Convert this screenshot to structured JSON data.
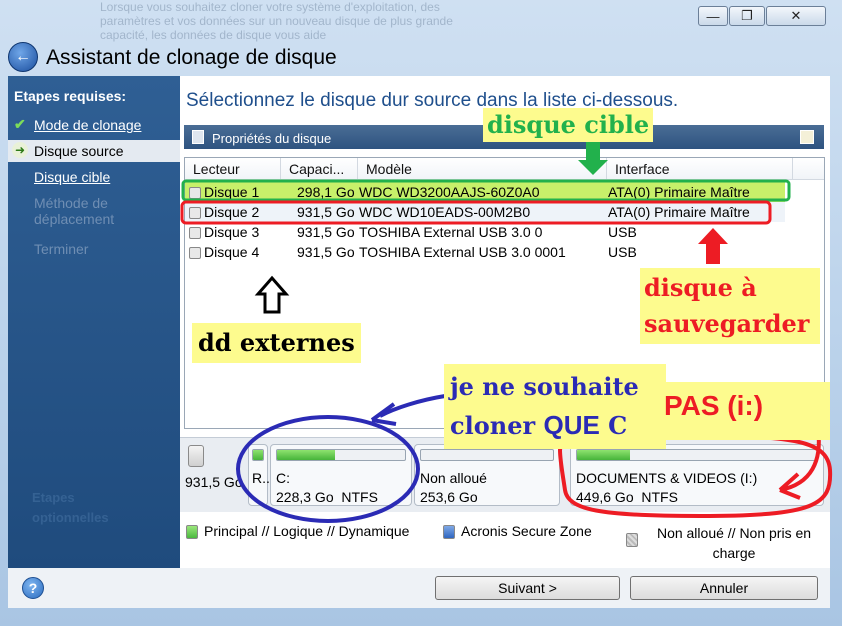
{
  "window": {
    "title": "Assistant de clonage de disque",
    "min_glyph": "—",
    "max_glyph": "❐",
    "close_glyph": "✕",
    "background_text": "Lorsque vous souhaitez cloner votre système d'exploitation, des paramètres et vos données sur un nouveau disque de plus grande capacité, les données de disque vous aide"
  },
  "sidebar": {
    "heading": "Etapes requises:",
    "items": [
      {
        "label": "Mode de clonage",
        "state": "done"
      },
      {
        "label": "Disque source",
        "state": "current"
      },
      {
        "label": "Disque cible",
        "state": "link"
      },
      {
        "label": "Méthode de déplacement",
        "state": "disabled"
      },
      {
        "label": "Terminer",
        "state": "disabled"
      }
    ],
    "optional_heading": "Etapes optionnelles"
  },
  "main": {
    "title": "Sélectionnez le disque dur source dans la liste ci-dessous.",
    "panel_label": "Propriétés du disque"
  },
  "table": {
    "columns": [
      "Lecteur",
      "Capaci...",
      "Modèle",
      "Interface"
    ],
    "rows": [
      {
        "lecteur": "Disque 1",
        "capacite": "298,1 Go",
        "modele": "WDC WD3200AAJS-60Z0A0",
        "interface": "ATA(0) Primaire Maître"
      },
      {
        "lecteur": "Disque 2",
        "capacite": "931,5 Go",
        "modele": "WDC WD10EADS-00M2B0",
        "interface": "ATA(0) Primaire Maître"
      },
      {
        "lecteur": "Disque 3",
        "capacite": "931,5 Go",
        "modele": "TOSHIBA External USB 3.0 0",
        "interface": "USB"
      },
      {
        "lecteur": "Disque 4",
        "capacite": "931,5 Go",
        "modele": "TOSHIBA External USB 3.0 0001",
        "interface": "USB"
      }
    ]
  },
  "partition_map": {
    "disk_size": "931,5 Go",
    "reserved_label": "R...",
    "partitions": [
      {
        "label": "C:",
        "size": "228,3 Go",
        "fs": "NTFS",
        "fill": 0.45
      },
      {
        "label": "Non alloué",
        "size": "253,6 Go",
        "fs": "",
        "fill": 0
      },
      {
        "label": "DOCUMENTS & VIDEOS (I:)",
        "size": "449,6 Go",
        "fs": "NTFS",
        "fill": 0.22
      }
    ]
  },
  "legend": {
    "principal": "Principal // Logique // Dynamique",
    "acronis": "Acronis Secure Zone",
    "non_alloue": "Non alloué // Non pris en charge"
  },
  "buttons": {
    "next": "Suivant >",
    "cancel": "Annuler",
    "help": "?"
  },
  "annotations": {
    "cible": "disque cible",
    "sauvegarder_line1": "disque à",
    "sauvegarder_line2": "sauvegarder",
    "externes": "dd externes",
    "cloner_line1": "je ne souhaite",
    "cloner_line2a": "cloner ",
    "cloner_que": "QUE",
    "cloner_c": " C",
    "pas": "PAS (i:)"
  },
  "colors": {
    "accent": "#1f4f8c",
    "sidebar": "#1f4b7d",
    "highlight_green": "#22b14c",
    "highlight_red": "#ed1c24",
    "annotation_blue": "#2b2bb5",
    "annotation_yellow": "#fdfb8e"
  }
}
